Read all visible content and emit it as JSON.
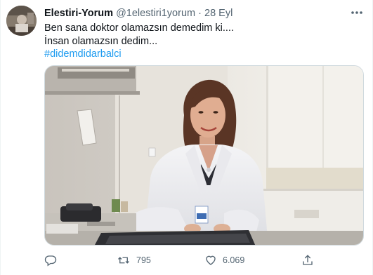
{
  "user": {
    "display_name": "Elestiri-Yorum",
    "handle": "@1elestiri1yorum",
    "separator": "·",
    "date": "28 Eyl",
    "avatar_icon": "profile-avatar"
  },
  "tweet": {
    "line1": "Ben sana doktor olamazsın demedim ki....",
    "line2": "İnsan olamazsın dedim...",
    "hashtag": "#didemdidarbalci"
  },
  "media": {
    "type": "photo",
    "subject": "doctor-in-white-coat-at-desk"
  },
  "actions": {
    "reply_count": "",
    "retweet_count": "795",
    "like_count": "6.069",
    "share_count": ""
  },
  "colors": {
    "text": "#0f1419",
    "muted": "#536471",
    "link": "#1d9bf0",
    "border": "#cfd9de"
  }
}
